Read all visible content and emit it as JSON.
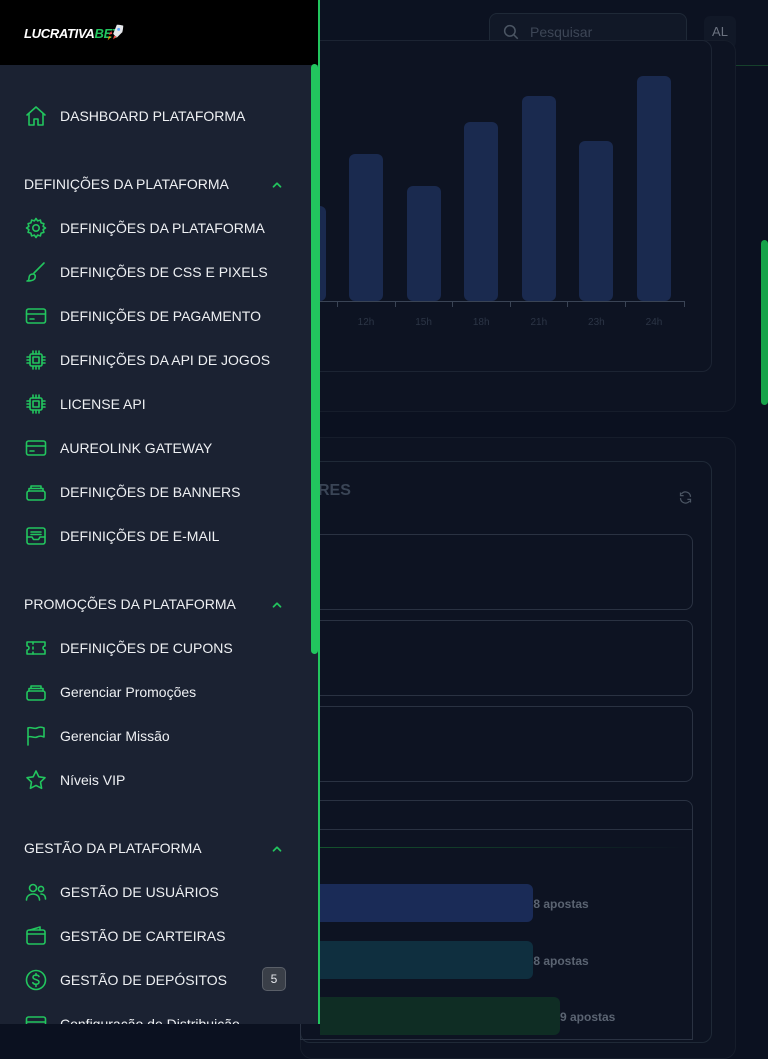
{
  "brand": {
    "logo_main": "LUCRATIVA",
    "logo_accent": "BET",
    "accent_color": "#22c55e"
  },
  "header": {
    "search_placeholder": "Pesquisar",
    "avatar_initials": "AL"
  },
  "background": {
    "chart_data": {
      "type": "bar",
      "categories": [
        "12h",
        "15h",
        "18h",
        "21h",
        "23h",
        "24h"
      ],
      "values": [
        147,
        115,
        179,
        205,
        160,
        225
      ],
      "ylim": [
        0,
        240
      ],
      "grid": false,
      "bar_color": "#1a2a4f"
    },
    "panel_title_fragment": "RES",
    "bets": [
      {
        "label": "8 apostas",
        "value": 8,
        "color": "#1a2b57"
      },
      {
        "label": "8 apostas",
        "value": 8,
        "color": "#0f2f3f"
      },
      {
        "label": "9 apostas",
        "value": 9,
        "color": "#0f2d24"
      }
    ]
  },
  "sidebar": {
    "dashboard": {
      "label": "DASHBOARD PLATAFORMA",
      "icon": "home-icon"
    },
    "sections": [
      {
        "title": "DEFINIÇÕES DA PLATAFORMA",
        "items": [
          {
            "label": "DEFINIÇÕES DA PLATAFORMA",
            "icon": "gear-icon"
          },
          {
            "label": "DEFINIÇÕES DE CSS E PIXELS",
            "icon": "brush-icon"
          },
          {
            "label": "DEFINIÇÕES DE PAGAMENTO",
            "icon": "credit-card-icon"
          },
          {
            "label": "DEFINIÇÕES DA API DE JOGOS",
            "icon": "cpu-chip-icon"
          },
          {
            "label": "LICENSE API",
            "icon": "cpu-chip-icon"
          },
          {
            "label": "AUREOLINK GATEWAY",
            "icon": "credit-card-icon"
          },
          {
            "label": "DEFINIÇÕES DE BANNERS",
            "icon": "stack-icon"
          },
          {
            "label": "DEFINIÇÕES DE E-MAIL",
            "icon": "inbox-icon"
          }
        ]
      },
      {
        "title": "PROMOÇÕES DA PLATAFORMA",
        "items": [
          {
            "label": "DEFINIÇÕES DE CUPONS",
            "icon": "ticket-icon"
          },
          {
            "label": "Gerenciar Promoções",
            "icon": "stack-icon"
          },
          {
            "label": "Gerenciar Missão",
            "icon": "flag-icon"
          },
          {
            "label": "Níveis VIP",
            "icon": "star-icon"
          }
        ]
      },
      {
        "title": "GESTÃO DA PLATAFORMA",
        "items": [
          {
            "label": "GESTÃO DE USUÁRIOS",
            "icon": "users-icon"
          },
          {
            "label": "GESTÃO DE CARTEIRAS",
            "icon": "wallet-icon"
          },
          {
            "label": "GESTÃO DE DEPÓSITOS",
            "icon": "dollar-circle-icon",
            "badge": "5"
          },
          {
            "label": "Configuração de Distribuição",
            "icon": "credit-card-icon"
          }
        ]
      }
    ]
  }
}
